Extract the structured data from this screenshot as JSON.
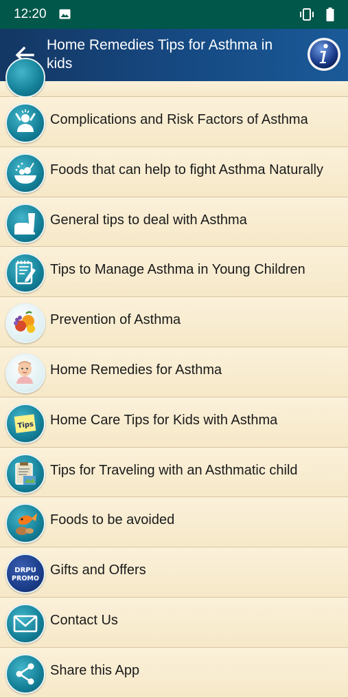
{
  "status_bar": {
    "time": "12:20"
  },
  "app_bar": {
    "title": "Home Remedies Tips for Asthma in kids"
  },
  "menu": [
    {
      "label": "Complications and Risk Factors of Asthma",
      "icon": "stressed-person-icon"
    },
    {
      "label": "Foods that can help to fight Asthma Naturally",
      "icon": "food-bowl-icon"
    },
    {
      "label": "General tips to deal with Asthma",
      "icon": "glass-and-bread-icon"
    },
    {
      "label": "Tips to Manage Asthma in Young Children",
      "icon": "notepad-pencil-icon"
    },
    {
      "label": "Prevention of Asthma",
      "icon": "fruits-icon"
    },
    {
      "label": "Home Remedies for Asthma",
      "icon": "baby-icon"
    },
    {
      "label": "Home Care Tips for Kids with Asthma",
      "icon": "tips-note-icon",
      "badge": "Tips"
    },
    {
      "label": "Tips for Traveling with an Asthmatic child",
      "icon": "clipboard-map-icon"
    },
    {
      "label": "Foods to be avoided",
      "icon": "fish-and-nut-icon"
    },
    {
      "label": "Gifts and Offers",
      "icon": "drpu-promo-icon",
      "badge": "DRPU PROMO"
    },
    {
      "label": "Contact Us",
      "icon": "envelope-icon"
    },
    {
      "label": "Share this App",
      "icon": "share-icon"
    }
  ],
  "colors": {
    "status_bar": "#00574a",
    "app_bar": "#164a83",
    "background": "#f7ecd2",
    "icon_teal": "#137f97"
  }
}
